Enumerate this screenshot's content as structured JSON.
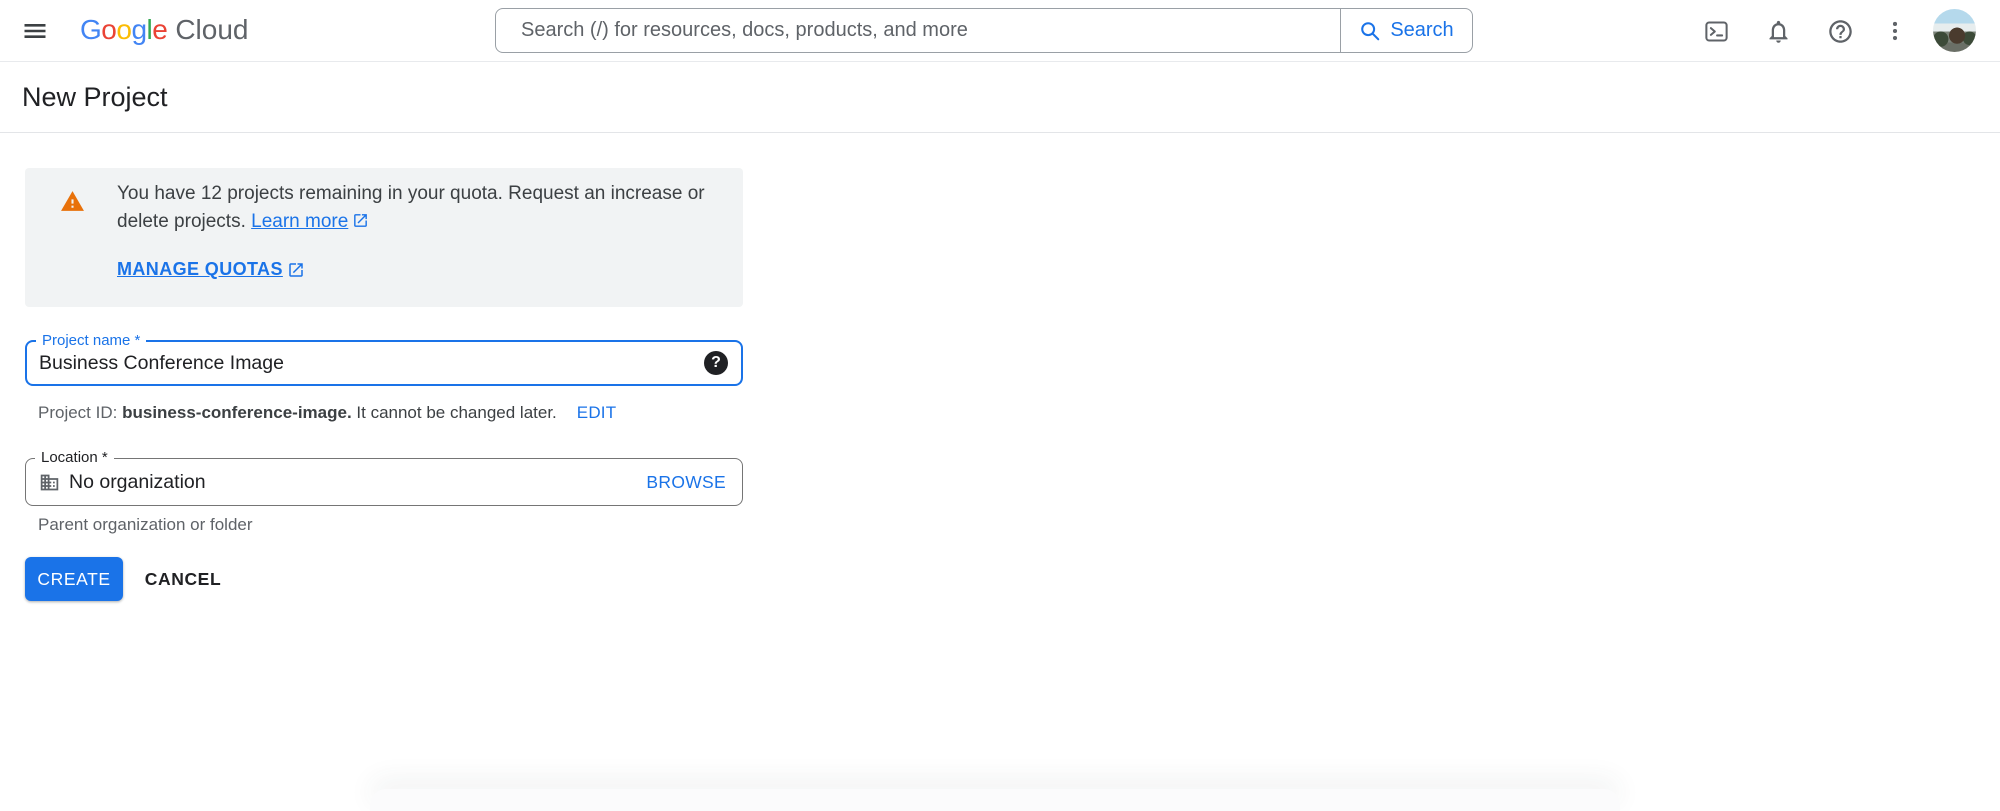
{
  "topbar": {
    "logo_letters": [
      "G",
      "o",
      "o",
      "g",
      "l",
      "e"
    ],
    "logo_cloud": "Cloud",
    "search_placeholder": "Search (/) for resources, docs, products, and more",
    "search_button": "Search",
    "icons": [
      "menu-icon",
      "cloud-shell-icon",
      "notifications-bell-icon",
      "help-icon",
      "more-vert-icon",
      "avatar"
    ]
  },
  "header": {
    "title": "New Project"
  },
  "warning": {
    "line1": "You have 12 projects remaining in your quota. Request an increase or",
    "line2_prefix": "delete projects. ",
    "learn_more_label": "Learn more",
    "manage_quotas_label": "MANAGE QUOTAS",
    "icon": "warning-triangle-icon"
  },
  "project_name": {
    "label": "Project name *",
    "value": "Business Conference Image",
    "help_glyph": "?"
  },
  "project_id": {
    "prefix": "Project ID: ",
    "id": "business-conference-image.",
    "suffix": " It cannot be changed later.",
    "edit_label": "EDIT"
  },
  "location": {
    "label": "Location *",
    "value": "No organization",
    "browse_label": "BROWSE",
    "helper": "Parent organization or folder",
    "icon": "organization-building-icon"
  },
  "actions": {
    "create_label": "CREATE",
    "cancel_label": "CANCEL"
  },
  "theme": {
    "accent_blue": "#1a73e8",
    "warning_orange": "#e8710a",
    "warning_bg": "#f1f3f4",
    "text_primary": "#202124",
    "text_secondary": "#5f6368",
    "google_blue": "#4285F4",
    "google_red": "#EA4335",
    "google_yellow": "#FBBC04",
    "google_green": "#34A853"
  }
}
